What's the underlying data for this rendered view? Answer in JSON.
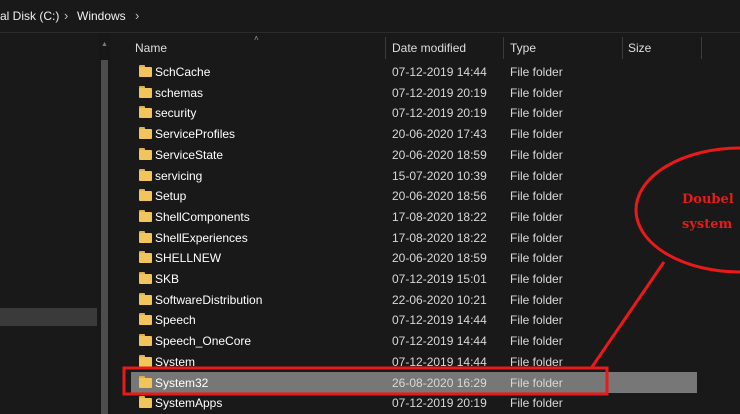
{
  "address_bar": {
    "crumbs": [
      "al Disk (C:)",
      "Windows"
    ]
  },
  "columns": {
    "name": "Name",
    "date_modified": "Date modified",
    "type": "Type",
    "size": "Size"
  },
  "rows": [
    {
      "name": "SchCache",
      "date": "07-12-2019 14:44",
      "type": "File folder"
    },
    {
      "name": "schemas",
      "date": "07-12-2019 20:19",
      "type": "File folder"
    },
    {
      "name": "security",
      "date": "07-12-2019 20:19",
      "type": "File folder"
    },
    {
      "name": "ServiceProfiles",
      "date": "20-06-2020 17:43",
      "type": "File folder"
    },
    {
      "name": "ServiceState",
      "date": "20-06-2020 18:59",
      "type": "File folder"
    },
    {
      "name": "servicing",
      "date": "15-07-2020 10:39",
      "type": "File folder"
    },
    {
      "name": "Setup",
      "date": "20-06-2020 18:56",
      "type": "File folder"
    },
    {
      "name": "ShellComponents",
      "date": "17-08-2020 18:22",
      "type": "File folder"
    },
    {
      "name": "ShellExperiences",
      "date": "17-08-2020 18:22",
      "type": "File folder"
    },
    {
      "name": "SHELLNEW",
      "date": "20-06-2020 18:59",
      "type": "File folder"
    },
    {
      "name": "SKB",
      "date": "07-12-2019 15:01",
      "type": "File folder"
    },
    {
      "name": "SoftwareDistribution",
      "date": "22-06-2020 10:21",
      "type": "File folder"
    },
    {
      "name": "Speech",
      "date": "07-12-2019 14:44",
      "type": "File folder"
    },
    {
      "name": "Speech_OneCore",
      "date": "07-12-2019 14:44",
      "type": "File folder"
    },
    {
      "name": "System",
      "date": "07-12-2019 14:44",
      "type": "File folder"
    },
    {
      "name": "System32",
      "date": "26-08-2020 16:29",
      "type": "File folder",
      "selected": true
    },
    {
      "name": "SystemApps",
      "date": "07-12-2019 20:19",
      "type": "File folder"
    }
  ],
  "annotation": {
    "line1": "Doubel",
    "line2": "system",
    "color": "#e81a1a"
  },
  "icons": {
    "folder": "folder-icon",
    "breadcrumb_separator": "chevron-right-icon",
    "sort": "sort-up-icon",
    "scroll_up": "scroll-up-icon"
  },
  "colors": {
    "background": "#191919",
    "selection": "#777777",
    "folder": "#f2c55c"
  }
}
